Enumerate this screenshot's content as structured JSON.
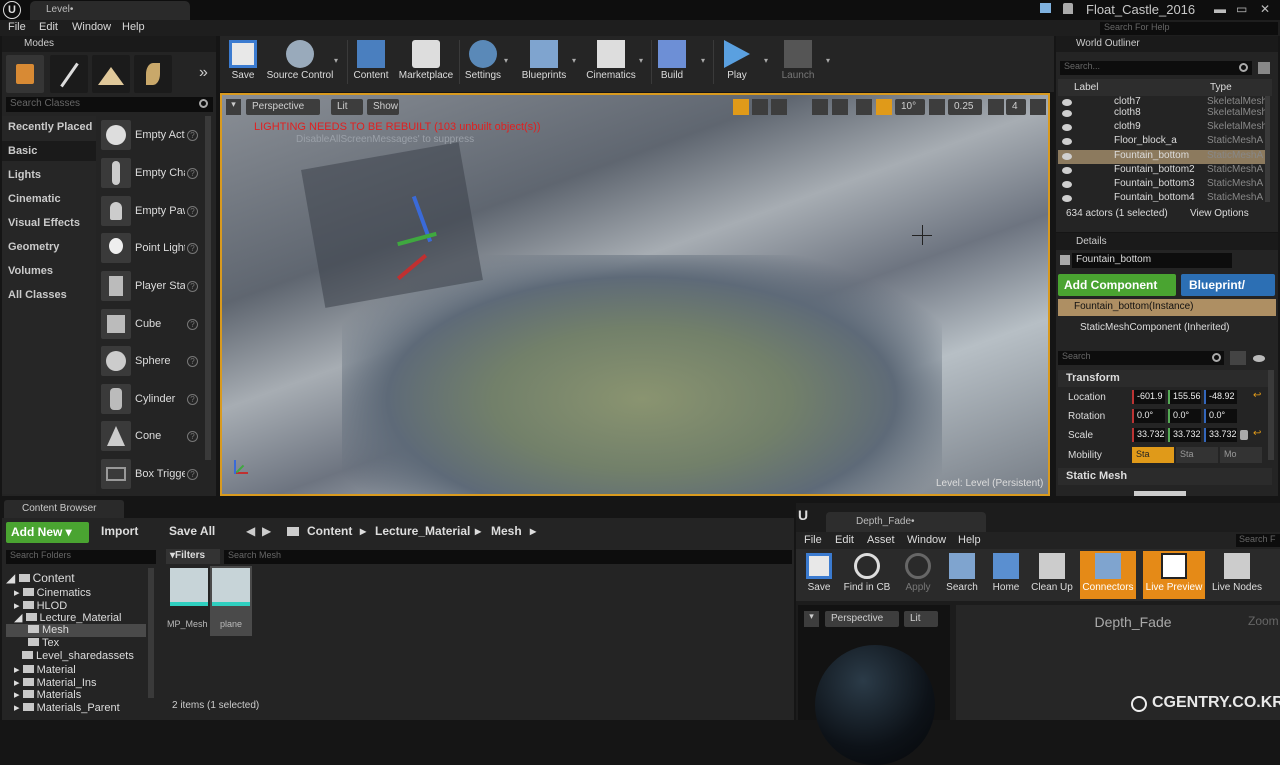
{
  "titlebar": {
    "level_tab": "Level•",
    "project": "Float_Castle_2016"
  },
  "menu": [
    "File",
    "Edit",
    "Window",
    "Help"
  ],
  "help_search_placeholder": "Search For Help",
  "modes": {
    "title": "Modes",
    "search_placeholder": "Search Classes",
    "categories": [
      "Recently Placed",
      "Basic",
      "Lights",
      "Cinematic",
      "Visual Effects",
      "Geometry",
      "Volumes",
      "All Classes"
    ],
    "actors": [
      "Empty Actor",
      "Empty Character",
      "Empty Pawn",
      "Point Light",
      "Player Start",
      "Cube",
      "Sphere",
      "Cylinder",
      "Cone",
      "Box Trigger"
    ]
  },
  "toolbar": [
    "Save",
    "Source Control",
    "Content",
    "Marketplace",
    "Settings",
    "Blueprints",
    "Cinematics",
    "Build",
    "Play",
    "Launch"
  ],
  "viewport": {
    "perspective": "Perspective",
    "lit": "Lit",
    "show": "Show",
    "grid": "10°",
    "scale": "0.25",
    "cam": "4",
    "warning": "LIGHTING NEEDS TO BE REBUILT (103 unbuilt object(s))",
    "message": "DisableAllScreenMessages' to suppress",
    "level": "Level: Level (Persistent)"
  },
  "outliner": {
    "title": "World Outliner",
    "search_placeholder": "Search...",
    "col_label": "Label",
    "col_type": "Type",
    "rows": [
      {
        "name": "cloth7",
        "type": "SkeletalMesh"
      },
      {
        "name": "cloth8",
        "type": "SkeletalMesh"
      },
      {
        "name": "cloth9",
        "type": "SkeletalMesh"
      },
      {
        "name": "Floor_block_a",
        "type": "StaticMeshA"
      },
      {
        "name": "Fountain_bottom",
        "type": "StaticMeshA"
      },
      {
        "name": "Fountain_bottom2",
        "type": "StaticMeshA"
      },
      {
        "name": "Fountain_bottom3",
        "type": "StaticMeshA"
      },
      {
        "name": "Fountain_bottom4",
        "type": "StaticMeshA"
      }
    ],
    "count": "634 actors (1 selected)",
    "view_options": "View Options"
  },
  "details": {
    "title": "Details",
    "name": "Fountain_bottom",
    "add_component": "Add Component",
    "blueprint": "Blueprint/",
    "instance": "Fountain_bottom(Instance)",
    "component": "StaticMeshComponent (Inherited)",
    "search_placeholder": "Search",
    "transform": "Transform",
    "location_label": "Location",
    "rotation_label": "Rotation",
    "scale_label": "Scale",
    "mobility_label": "Mobility",
    "location": [
      "-601.9",
      "155.56",
      "-48.92"
    ],
    "rotation": [
      "0.0°",
      "0.0°",
      "0.0°"
    ],
    "scale": [
      "33.732",
      "33.732",
      "33.732"
    ],
    "mobility": [
      "Sta",
      "Sta",
      "Mo"
    ],
    "static_mesh": "Static Mesh"
  },
  "content_browser": {
    "tab": "Content Browser",
    "add_new": "Add New",
    "import": "Import",
    "save_all": "Save All",
    "breadcrumb": [
      "Content",
      "Lecture_Material",
      "Mesh"
    ],
    "search_folders": "Search Folders",
    "filters": "Filters",
    "search_mesh": "Search Mesh",
    "folders": [
      "Content",
      "Cinematics",
      "HLOD",
      "Lecture_Material",
      "Mesh",
      "Tex",
      "Level_sharedassets",
      "Material",
      "Material_Ins",
      "Materials",
      "Materials_Parent"
    ],
    "assets": [
      "MP_Mesh",
      "plane"
    ],
    "items": "2 items (1 selected)"
  },
  "material_editor": {
    "tab": "Depth_Fade•",
    "menu": [
      "File",
      "Edit",
      "Asset",
      "Window",
      "Help"
    ],
    "search": "Search F",
    "toolbar": [
      "Save",
      "Find in CB",
      "Apply",
      "Search",
      "Home",
      "Clean Up",
      "Connectors",
      "Live Preview",
      "Live Nodes"
    ],
    "perspective": "Perspective",
    "lit": "Lit",
    "graph_title": "Depth_Fade",
    "zoom": "Zoom"
  },
  "watermark": "CGENTRY.CO.KR",
  "colors": {
    "accent_orange": "#e09a19",
    "add_green": "#4aa431",
    "blueprint_blue": "#2c6fb4",
    "warning_red": "#e02020"
  }
}
